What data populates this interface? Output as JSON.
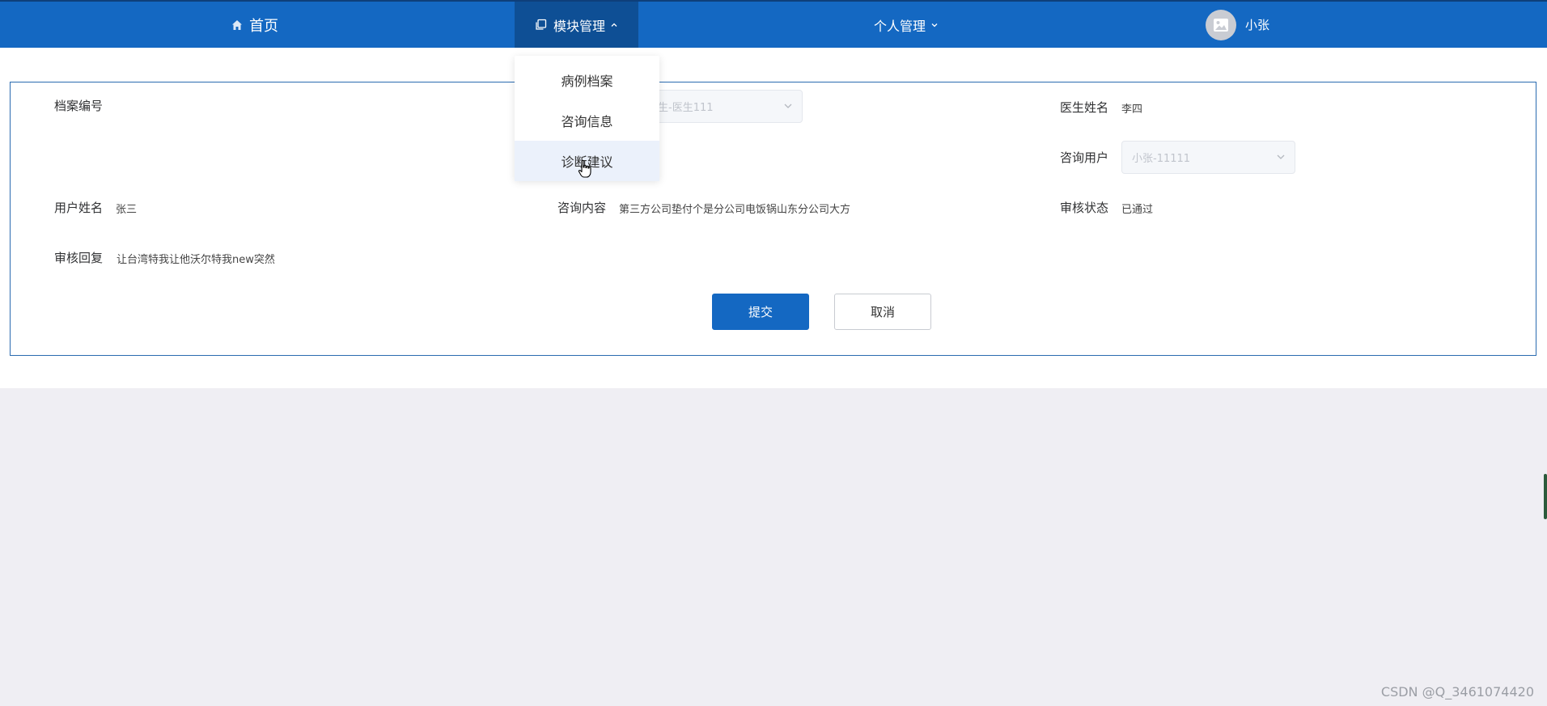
{
  "nav": {
    "home": {
      "icon": "home-icon",
      "label": "首页"
    },
    "module": {
      "icon": "copy-icon",
      "label": "模块管理",
      "caret": "chevron-up-icon"
    },
    "personal": {
      "label": "个人管理",
      "caret": "chevron-down-icon"
    },
    "user": {
      "avatar": "image-icon",
      "name": "小张"
    }
  },
  "dropdown": {
    "items": [
      {
        "label": "病例档案"
      },
      {
        "label": "咨询信息"
      },
      {
        "label": "诊断建议",
        "active": true
      }
    ]
  },
  "form": {
    "archive_no": {
      "label": "档案编号",
      "value": ""
    },
    "doctor_account": {
      "value": "医生-医生111"
    },
    "doctor_name": {
      "label": "医生姓名",
      "value": "李四"
    },
    "consult_user": {
      "label": "咨询用户",
      "value": "小张-11111"
    },
    "user_name": {
      "label": "用户姓名",
      "value": "张三"
    },
    "consult_content": {
      "label": "咨询内容",
      "value": "第三方公司垫付个是分公司电饭锅山东分公司大方"
    },
    "review_status": {
      "label": "审核状态",
      "value": "已通过"
    },
    "review_reply": {
      "label": "审核回复",
      "value": "让台湾特我让他沃尔特我new突然"
    },
    "submit_label": "提交",
    "cancel_label": "取消"
  },
  "colors": {
    "nav_bg": "#1468c2",
    "nav_active_bg": "#0e4f95",
    "primary": "#1468c2",
    "page_bg": "#efeef3"
  },
  "watermark": "CSDN @Q_3461074420"
}
